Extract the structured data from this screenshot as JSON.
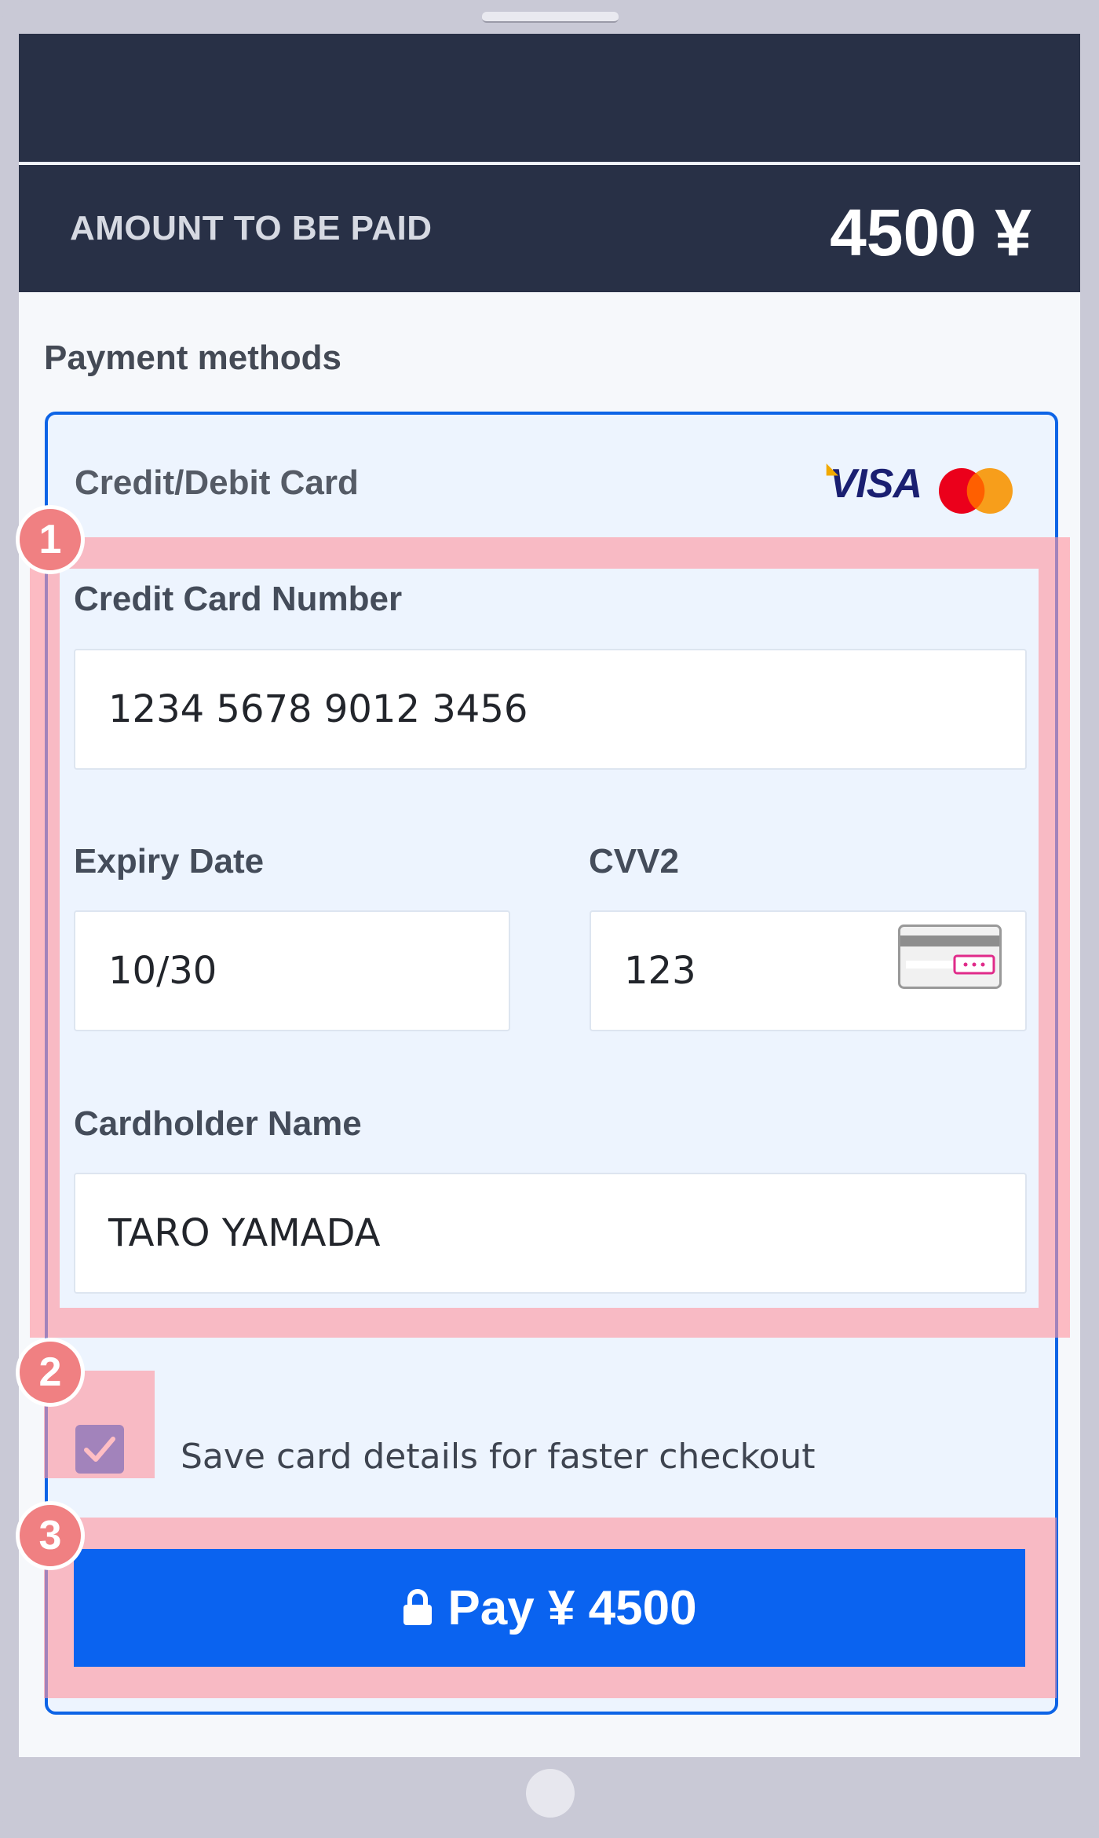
{
  "header": {
    "amount_label": "AMOUNT TO BE PAID",
    "amount_value": "4500 ¥"
  },
  "payment": {
    "section_title": "Payment methods",
    "method_title": "Credit/Debit Card",
    "brands": {
      "visa": "VISA",
      "mastercard": "mastercard-logo"
    },
    "fields": {
      "card_number_label": "Credit Card Number",
      "card_number_value": "1234 5678 9012 3456",
      "expiry_label": "Expiry Date",
      "expiry_value": "10/30",
      "cvv_label": "CVV2",
      "cvv_value": "123",
      "cardholder_label": "Cardholder Name",
      "cardholder_value": "TARO YAMADA"
    },
    "save_card": {
      "checked": true,
      "label": "Save card details for faster checkout"
    },
    "pay_button": {
      "icon": "lock-icon",
      "label": "Pay ¥ 4500"
    }
  },
  "annotations": {
    "badges": [
      "1",
      "2",
      "3"
    ]
  },
  "colors": {
    "header_bg": "#283046",
    "accent": "#0a63f0",
    "card_bg": "#edf4fe",
    "highlight": "#ff96a0",
    "badge": "#f08082"
  }
}
